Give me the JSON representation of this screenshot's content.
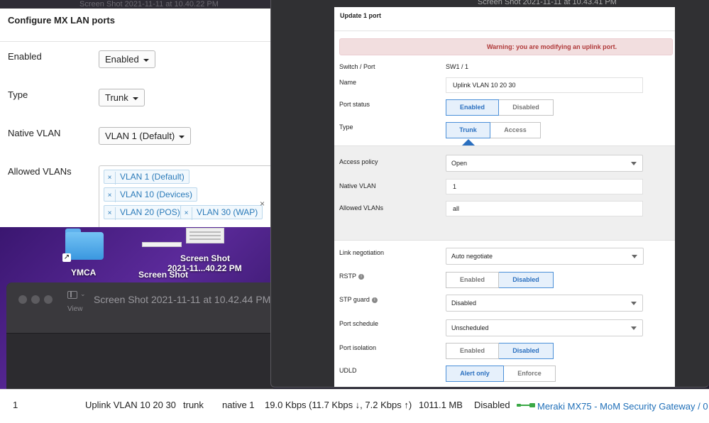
{
  "configure_window": {
    "strip_text": "Screen Shot 2021-11-11 at 10.40.22 PM",
    "title": "Configure MX LAN ports",
    "enabled_label": "Enabled",
    "enabled_value": "Enabled",
    "type_label": "Type",
    "type_value": "Trunk",
    "native_vlan_label": "Native VLAN",
    "native_vlan_value": "VLAN 1 (Default)",
    "allowed_vlans_label": "Allowed VLANs",
    "allowed_vlans": [
      "VLAN 1 (Default)",
      "VLAN 10 (Devices)",
      "VLAN 20 (POS)",
      "VLAN 30 (WAP)"
    ]
  },
  "desktop": {
    "folder_label": "YMCA",
    "file1_label_line1": "Screen Shot",
    "file1_label_line2": "2021-11...40.22 PM",
    "file2_label": "Screen Shot"
  },
  "preview_window": {
    "title": "Screen Shot 2021-11-11 at 10.42.44 PM",
    "view_label": "View"
  },
  "update_window": {
    "strip_text": "Screen Shot 2021-11-11 at 10.43.41 PM",
    "title": "Update 1 port",
    "warning": "Warning: you are modifying an uplink port.",
    "switch_port_label": "Switch / Port",
    "switch_port_value": "SW1 / 1",
    "name_label": "Name",
    "name_value": "Uplink VLAN 10 20 30",
    "port_status_label": "Port status",
    "port_status_options": [
      "Enabled",
      "Disabled"
    ],
    "port_status_selected": "Enabled",
    "type_label": "Type",
    "type_options": [
      "Trunk",
      "Access"
    ],
    "type_selected": "Trunk",
    "access_policy_label": "Access policy",
    "access_policy_value": "Open",
    "native_vlan_label": "Native VLAN",
    "native_vlan_value": "1",
    "allowed_vlans_label": "Allowed VLANs",
    "allowed_vlans_value": "all",
    "link_negotiation_label": "Link negotiation",
    "link_negotiation_value": "Auto negotiate",
    "rstp_label": "RSTP",
    "rstp_options": [
      "Enabled",
      "Disabled"
    ],
    "rstp_selected": "Disabled",
    "stp_guard_label": "STP guard",
    "stp_guard_value": "Disabled",
    "port_schedule_label": "Port schedule",
    "port_schedule_value": "Unscheduled",
    "port_isolation_label": "Port isolation",
    "port_isolation_options": [
      "Enabled",
      "Disabled"
    ],
    "port_isolation_selected": "Disabled",
    "udld_label": "UDLD",
    "udld_options": [
      "Alert only",
      "Enforce"
    ],
    "udld_selected": "Alert only",
    "info_glyph": "i"
  },
  "port_row": {
    "port": "1",
    "name": "Uplink VLAN 10 20 30",
    "type": "trunk",
    "vlan": "native 1",
    "usage": "19.0 Kbps (11.7 Kbps ↓, 7.2 Kbps ↑)",
    "data": "1011.1 MB",
    "status": "Disabled",
    "device": "Meraki MX75 - MoM Security Gateway / 0",
    "accent_color": "#1f6fb8",
    "cable_color": "#3aa845"
  }
}
